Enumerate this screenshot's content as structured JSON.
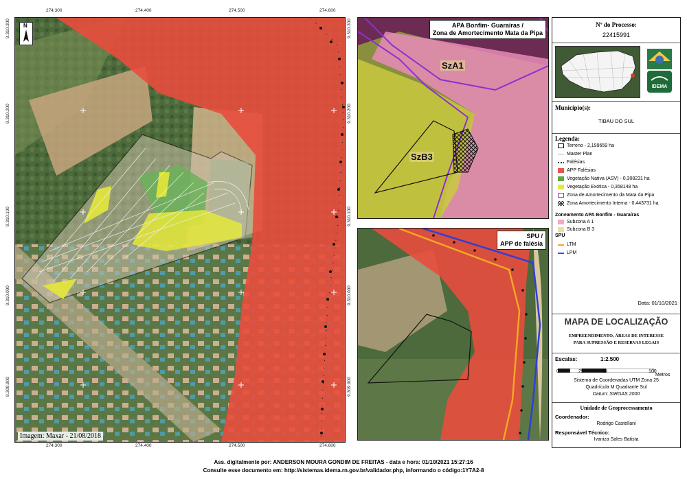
{
  "main_map": {
    "x_ticks": [
      "274.300",
      "274.400",
      "274.500",
      "274.600"
    ],
    "x_ticks_bottom": [
      "274.300",
      "274.400",
      "274.500",
      "274.600"
    ],
    "y_ticks": [
      "9.310.300",
      "9.310.200",
      "9.310.100",
      "9.310.000",
      "9.309.900"
    ],
    "north_label": "N",
    "caption": "Imagem: Maxar - 21/08/2018"
  },
  "inset_apa": {
    "title_line1": "APA Bonfim- Guaraíras /",
    "title_line2": "Zona de Amortecimento Mata da Pipa",
    "label_a1": "SzA1",
    "label_b3": "SzB3"
  },
  "inset_spu": {
    "title_line1": "SPU /",
    "title_line2": "APP de falésia"
  },
  "sidebar": {
    "process_label": "Nº do Processo:",
    "process_number": "22415991",
    "municipio_label": "Município(s):",
    "municipio": "TIBAU DO SUL",
    "legend_title": "Legenda:",
    "legend_items": [
      {
        "label": "Terreno - 2,199659 ha",
        "color": "#ffffff",
        "style": "outline"
      },
      {
        "label": "Master Plan",
        "color": "#aaaaaa",
        "style": "line"
      },
      {
        "label": "Falésias",
        "color": "#111111",
        "style": "dots"
      },
      {
        "label": "APP Falésias",
        "color": "#e8564a",
        "style": "fill"
      },
      {
        "label": "Vegetação Nativa (ASV) - 0,308231 ha",
        "color": "#5fa84a",
        "style": "fill"
      },
      {
        "label": "Vegetação Exótica - 0,358148 ha",
        "color": "#e6e83a",
        "style": "fill"
      },
      {
        "label": "Zona de Amortecimento da Mata da Pipa",
        "color": "#9b35c9",
        "style": "outline"
      },
      {
        "label": "Zona Amortecimento Interna - 0,443731 ha",
        "color": "#222222",
        "style": "hatch"
      }
    ],
    "zone_title": "Zoneamento APA Bonfim - Guaraíras",
    "zone_items": [
      {
        "label": "Subzona A 1",
        "color": "#f2a7c8"
      },
      {
        "label": "Subzona B 3",
        "color": "#e4e6a0"
      }
    ],
    "spu_title": "SPU",
    "spu_items": [
      {
        "label": "LTM",
        "color": "#f5a623"
      },
      {
        "label": "LPM",
        "color": "#2f5bd6"
      }
    ],
    "date": "Data: 01/10/2021",
    "map_title": "MAPA DE LOCALIZAÇÃO",
    "subtitle_line1": "EMPREENDIMENTO, ÁREAS DE INTERESSE",
    "subtitle_line2": "PARA SUPRESSÃO E RESERVAS LEGAIS",
    "scales_label": "Escalas:",
    "scale_value": "1:2.500",
    "scale_ticks": [
      "0",
      "25",
      "50",
      "100"
    ],
    "scale_unit": "Metros",
    "crs_line1": "Sistema de Coordenadas UTM Zona 25",
    "crs_line2": "Quadrícula M  Quadrante Sul",
    "crs_line3": "Datum: SIRGAS 2000",
    "unit_title": "Unidade de Geoprocessamento",
    "coord_label": "Coordenador:",
    "coord_name": "Rodrigo Castellani",
    "tech_label": "Responsável Técnico:",
    "tech_name": "Ivaniza Sales Batista",
    "logo_text": "IDEMA"
  },
  "footer": {
    "line1": "Ass. digitalmente por: ANDERSON MOURA GONDIM DE FREITAS - data e hora: 01/10/2021 15:27:16",
    "line2": "Consulte esse documento em: http://sistemas.idema.rn.gov.br/validador.php, informando o código:1Y7A2-8"
  }
}
